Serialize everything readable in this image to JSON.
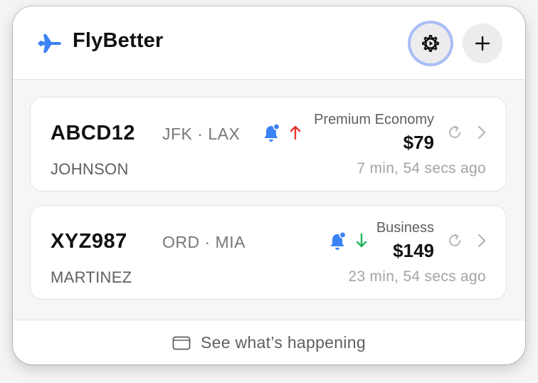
{
  "app": {
    "title": "FlyBetter",
    "logo_icon": "airplane-icon",
    "brand_color": "#3b82f6"
  },
  "toolbar": {
    "settings_icon": "gear-icon",
    "add_icon": "plus-icon"
  },
  "bookings": [
    {
      "code": "ABCD12",
      "route": "JFK · LAX",
      "name": "JOHNSON",
      "cabin": "Premium Economy",
      "price": "$79",
      "updated": "7 min, 54 secs ago",
      "alert_icon": "bell-badge-icon",
      "trend": "up",
      "trend_color": "#e5322d"
    },
    {
      "code": "XYZ987",
      "route": "ORD · MIA",
      "name": "MARTINEZ",
      "cabin": "Business",
      "price": "$149",
      "updated": "23 min, 54 secs ago",
      "alert_icon": "bell-badge-icon",
      "trend": "down",
      "trend_color": "#22b35b"
    }
  ],
  "footer": {
    "label": "See what’s happening",
    "icon": "window-icon"
  }
}
